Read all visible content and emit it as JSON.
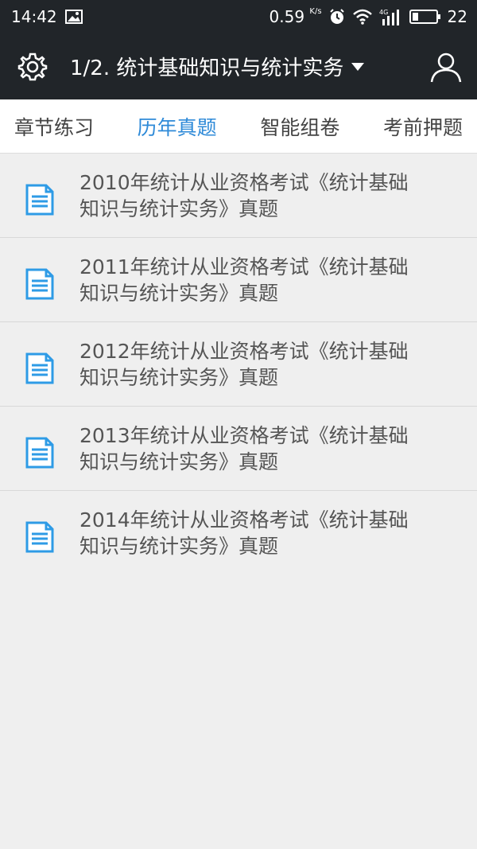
{
  "status": {
    "time": "14:42",
    "speed": "0.59",
    "speed_unit": "K/s",
    "network": "4G",
    "battery": "22"
  },
  "appbar": {
    "title": "1/2. 统计基础知识与统计实务",
    "settings_icon": "gear-icon",
    "user_icon": "user-icon"
  },
  "tabs": [
    {
      "label": "章节练习",
      "active": false
    },
    {
      "label": "历年真题",
      "active": true
    },
    {
      "label": "智能组卷",
      "active": false
    },
    {
      "label": "考前押题",
      "active": false
    }
  ],
  "items": [
    {
      "line1": "2010年统计从业资格考试《统计基础",
      "line2": "知识与统计实务》真题"
    },
    {
      "line1": "2011年统计从业资格考试《统计基础",
      "line2": "知识与统计实务》真题"
    },
    {
      "line1": "2012年统计从业资格考试《统计基础",
      "line2": "知识与统计实务》真题"
    },
    {
      "line1": "2013年统计从业资格考试《统计基础",
      "line2": "知识与统计实务》真题"
    },
    {
      "line1": "2014年统计从业资格考试《统计基础",
      "line2": "知识与统计实务》真题"
    }
  ],
  "colors": {
    "bar": "#212529",
    "accent": "#2e8ad8",
    "doc_icon": "#2e9be6"
  }
}
